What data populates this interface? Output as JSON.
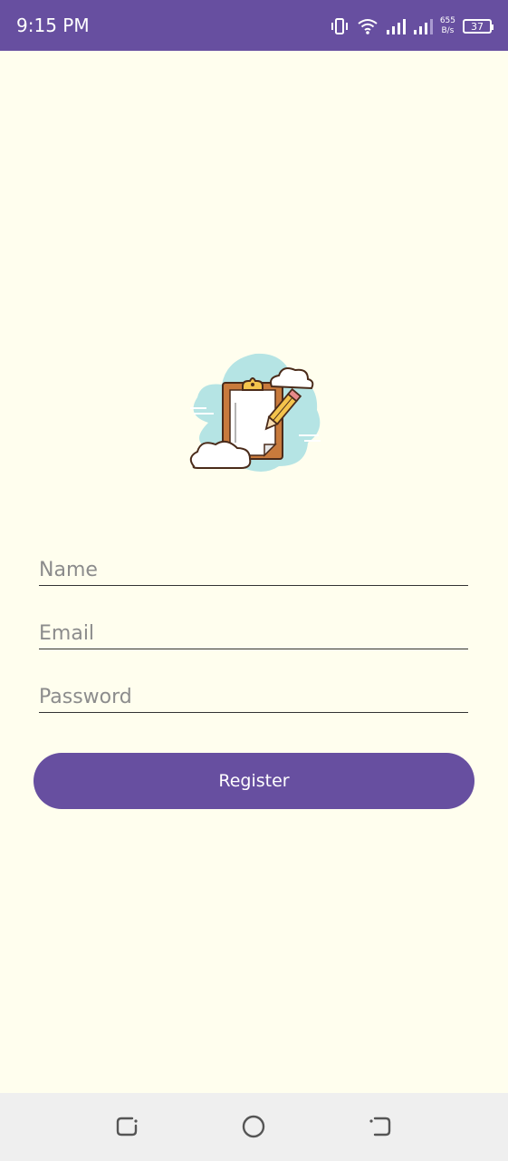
{
  "status_bar": {
    "time": "9:15 PM",
    "net_speed_value": "655",
    "net_speed_unit": "B/s",
    "battery": "37",
    "background_color": "#674fa0"
  },
  "form": {
    "name_placeholder": "Name",
    "email_placeholder": "Email",
    "password_placeholder": "Password",
    "register_label": "Register"
  },
  "icons": {
    "logo": "clipboard-pencil-clouds-icon",
    "status": [
      "vibrate-icon",
      "wifi-icon",
      "signal-icon",
      "signal-icon",
      "battery-icon"
    ],
    "nav": [
      "back-icon",
      "home-icon",
      "recent-apps-icon"
    ]
  },
  "colors": {
    "page_background": "#fffeee",
    "accent": "#674fa0",
    "nav_background": "#efefef"
  }
}
